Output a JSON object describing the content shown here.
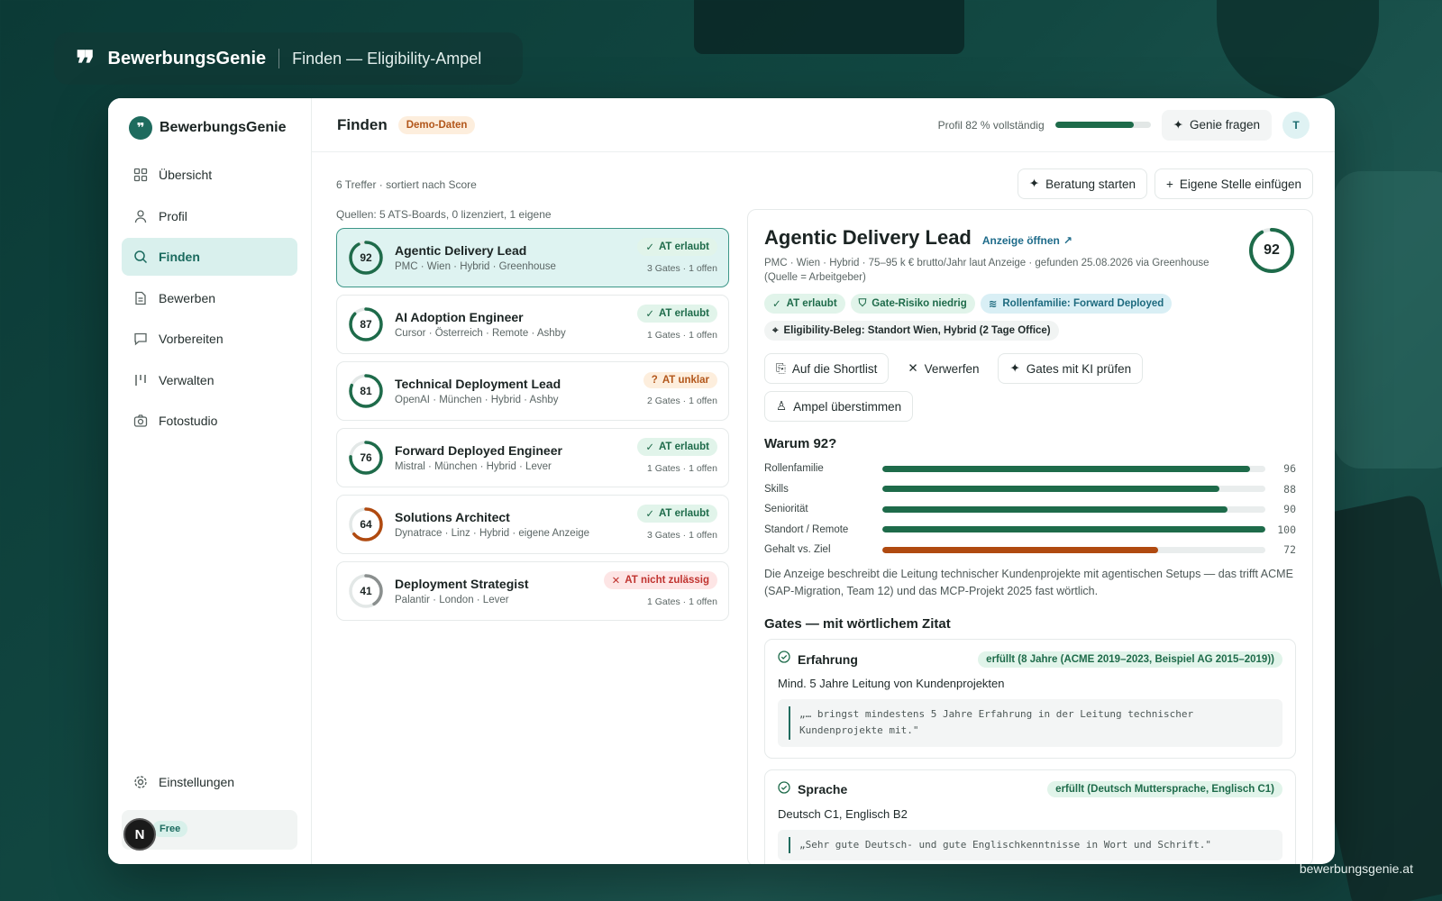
{
  "brand": {
    "name": "BewerbungsGenie",
    "subtitle": "Finden — Eligibility-Ampel",
    "url": "bewerbungsgenie.at"
  },
  "sidebar": {
    "logo": "BewerbungsGenie",
    "items": [
      {
        "label": "Übersicht",
        "icon": "grid-icon"
      },
      {
        "label": "Profil",
        "icon": "user-icon"
      },
      {
        "label": "Finden",
        "icon": "search-icon",
        "active": true
      },
      {
        "label": "Bewerben",
        "icon": "document-icon"
      },
      {
        "label": "Vorbereiten",
        "icon": "chat-icon"
      },
      {
        "label": "Verwalten",
        "icon": "kanban-icon"
      },
      {
        "label": "Fotostudio",
        "icon": "camera-icon"
      }
    ],
    "settings_label": "Einstellungen",
    "plan_label": "Free",
    "dev_badge": "N"
  },
  "topbar": {
    "title": "Finden",
    "demo_badge": "Demo-Daten",
    "profile_progress_text": "Profil 82 % vollständig",
    "profile_progress": 0.82,
    "ask_button": "Genie fragen",
    "avatar_initial": "T"
  },
  "list": {
    "summary": "6 Treffer · sortiert nach Score",
    "sources": "Quellen: 5 ATS-Boards, 0 lizenziert, 1 eigene",
    "jobs": [
      {
        "score": 92,
        "title": "Agentic Delivery Lead",
        "meta": "PMC · Wien · Hybrid · Greenhouse",
        "status": "AT erlaubt",
        "kind": "ok",
        "gates": "3 Gates · 1 offen"
      },
      {
        "score": 87,
        "title": "AI Adoption Engineer",
        "meta": "Cursor · Österreich · Remote · Ashby",
        "status": "AT erlaubt",
        "kind": "ok",
        "gates": "1 Gates · 1 offen"
      },
      {
        "score": 81,
        "title": "Technical Deployment Lead",
        "meta": "OpenAI · München · Hybrid · Ashby",
        "status": "AT unklar",
        "kind": "unclear",
        "gates": "2 Gates · 1 offen"
      },
      {
        "score": 76,
        "title": "Forward Deployed Engineer",
        "meta": "Mistral · München · Hybrid · Lever",
        "status": "AT erlaubt",
        "kind": "ok",
        "gates": "1 Gates · 1 offen"
      },
      {
        "score": 64,
        "title": "Solutions Architect",
        "meta": "Dynatrace · Linz · Hybrid · eigene Anzeige",
        "status": "AT erlaubt",
        "kind": "ok",
        "gates": "3 Gates · 1 offen"
      },
      {
        "score": 41,
        "title": "Deployment Strategist",
        "meta": "Palantir · London · Lever",
        "status": "AT nicht zulässig",
        "kind": "no",
        "gates": "1 Gates · 1 offen"
      }
    ]
  },
  "toolbar": {
    "consult_button": "Beratung starten",
    "own_job_button": "Eigene Stelle einfügen"
  },
  "detail": {
    "title": "Agentic Delivery Lead",
    "open_link": "Anzeige öffnen",
    "meta": "PMC · Wien · Hybrid · 75–95 k € brutto/Jahr laut Anzeige · gefunden 25.08.2026 via Greenhouse (Quelle = Arbeitgeber)",
    "score": 92,
    "chips": {
      "at": "AT erlaubt",
      "risk": "Gate-Risiko niedrig",
      "role_family": "Rollenfamilie:  Forward Deployed",
      "evidence": "Eligibility-Beleg: Standort Wien, Hybrid (2 Tage Office)"
    },
    "actions": {
      "shortlist": "Auf die Shortlist",
      "discard": "Verwerfen",
      "ai_check": "Gates mit KI prüfen",
      "override": "Ampel überstimmen"
    },
    "why_heading": "Warum 92?",
    "breakdown": [
      {
        "label": "Rollenfamilie",
        "value": 96,
        "color": "#1e6b4a"
      },
      {
        "label": "Skills",
        "value": 88,
        "color": "#1e6b4a"
      },
      {
        "label": "Seniorität",
        "value": 90,
        "color": "#1e6b4a"
      },
      {
        "label": "Standort / Remote",
        "value": 100,
        "color": "#1e6b4a"
      },
      {
        "label": "Gehalt vs. Ziel",
        "value": 72,
        "color": "#b04a10"
      }
    ],
    "rationale": "Die Anzeige beschreibt die Leitung technischer Kundenprojekte mit agentischen Setups — das trifft ACME (SAP-Migration, Team 12) und das MCP-Projekt 2025 fast wörtlich.",
    "gates_heading": "Gates — mit wörtlichem Zitat",
    "gates": [
      {
        "name": "Erfahrung",
        "status": "erfüllt (8 Jahre (ACME 2019–2023, Beispiel AG 2015–2019))",
        "requirement": "Mind. 5 Jahre Leitung von Kundenprojekten",
        "quote": "„… bringst mindestens 5 Jahre Erfahrung in der Leitung technischer Kundenprojekte mit.\""
      },
      {
        "name": "Sprache",
        "status": "erfüllt (Deutsch Muttersprache, Englisch C1)",
        "requirement": "Deutsch C1, Englisch B2",
        "quote": "„Sehr gute Deutsch- und gute Englischkenntnisse in Wort und Schrift.\""
      }
    ]
  },
  "colors": {
    "accent": "#1e6b5e",
    "ok": "#1e6b4a",
    "warn": "#b2561a",
    "error": "#c0332f"
  }
}
